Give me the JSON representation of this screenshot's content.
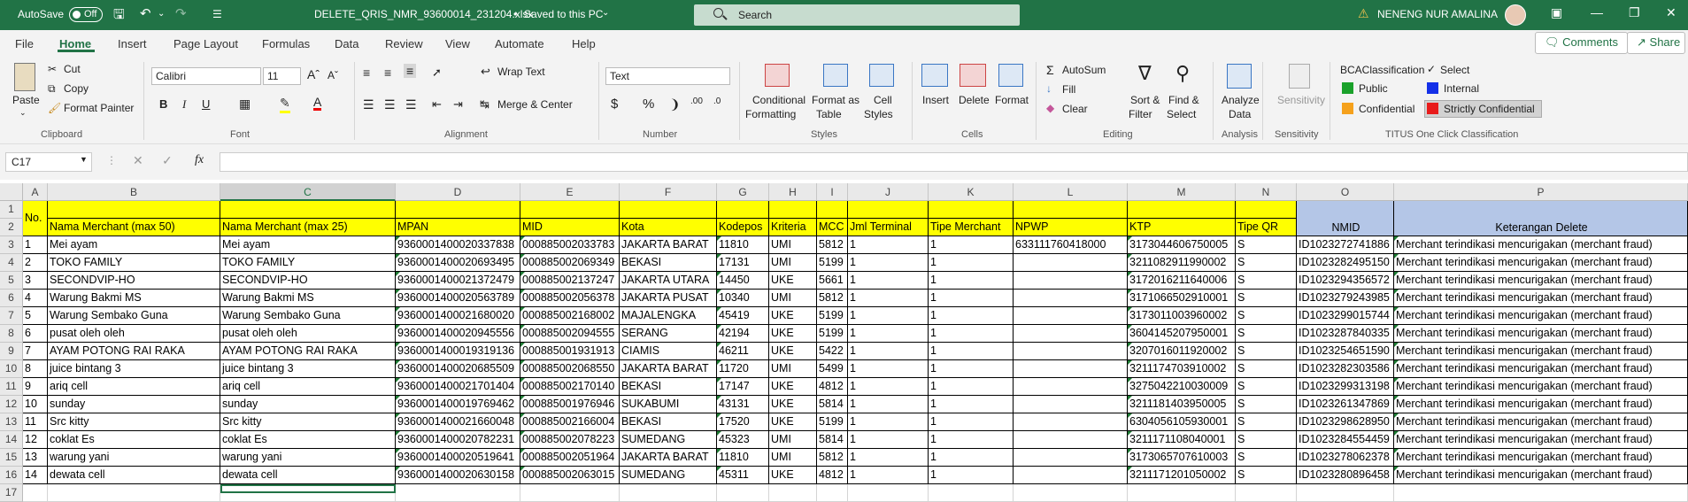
{
  "titlebar": {
    "autosave": "AutoSave",
    "toggle": "Off",
    "filename": "DELETE_QRIS_NMR_93600014_231204.xlsx",
    "saved": "Saved to this PC",
    "search_placeholder": "Search",
    "user": "NENENG NUR AMALINA",
    "color": "#217346"
  },
  "menu": {
    "tabs": [
      "File",
      "Home",
      "Insert",
      "Page Layout",
      "Formulas",
      "Data",
      "Review",
      "View",
      "Automate",
      "Help"
    ],
    "comments": "Comments",
    "share": "Share"
  },
  "ribbon": {
    "clipboard": {
      "paste": "Paste",
      "cut": "Cut",
      "copy": "Copy",
      "painter": "Format Painter",
      "label": "Clipboard"
    },
    "font": {
      "name": "Calibri",
      "size": "11",
      "label": "Font",
      "bold": "B",
      "italic": "I",
      "underline": "U"
    },
    "alignment": {
      "wrap": "Wrap Text",
      "merge": "Merge & Center",
      "label": "Alignment"
    },
    "number": {
      "format": "Text",
      "label": "Number"
    },
    "styles": {
      "cond1": "Conditional",
      "cond2": "Formatting",
      "fmt1": "Format as",
      "fmt2": "Table",
      "cell1": "Cell",
      "cell2": "Styles",
      "label": "Styles"
    },
    "cells": {
      "insert": "Insert",
      "delete": "Delete",
      "format": "Format",
      "label": "Cells"
    },
    "editing": {
      "autosum": "AutoSum",
      "fill": "Fill",
      "clear": "Clear",
      "sort1": "Sort &",
      "sort2": "Filter",
      "find1": "Find &",
      "find2": "Select",
      "label": "Editing"
    },
    "analysis": {
      "a1": "Analyze",
      "a2": "Data",
      "label": "Analysis"
    },
    "sensitivity": {
      "s1": "Sensitivity",
      "label": "Sensitivity"
    },
    "titus": {
      "bca": "BCAClassification",
      "select": "Select",
      "public": "Public",
      "internal": "Internal",
      "confidential": "Confidential",
      "strict": "Strictly Confidential",
      "label": "TITUS One Click Classification"
    }
  },
  "formula": {
    "namebox": "C17",
    "fx": "fx",
    "content": ""
  },
  "sheet": {
    "columns": [
      "A",
      "B",
      "C",
      "D",
      "E",
      "F",
      "G",
      "H",
      "I",
      "J",
      "K",
      "L",
      "M",
      "N",
      "O",
      "P"
    ],
    "header_no": "No.",
    "headers": [
      "Nama Merchant (max 50)",
      "Nama Merchant (max 25)",
      "MPAN",
      "MID",
      "Kota",
      "Kodepos",
      "Kriteria",
      "MCC",
      "Jml Terminal",
      "Tipe Merchant",
      "NPWP",
      "KTP",
      "Tipe QR",
      "NMID",
      "Keterangan Delete"
    ],
    "rows": [
      [
        "1",
        "Mei ayam",
        "Mei ayam",
        "9360001400020337838",
        "000885002033783",
        "JAKARTA BARAT",
        "11810",
        "UMI",
        "5812",
        "1",
        "1",
        "633111760418000",
        "3173044606750005",
        "S",
        "ID1023272741886",
        "Merchant terindikasi mencurigakan (merchant fraud)"
      ],
      [
        "2",
        "TOKO FAMILY",
        "TOKO FAMILY",
        "9360001400020693495",
        "000885002069349",
        "BEKASI",
        "17131",
        "UMI",
        "5199",
        "1",
        "1",
        "",
        "3211082911990002",
        "S",
        "ID1023282495150",
        "Merchant terindikasi mencurigakan (merchant fraud)"
      ],
      [
        "3",
        "SECONDVIP-HO",
        "SECONDVIP-HO",
        "9360001400021372479",
        "000885002137247",
        "JAKARTA UTARA",
        "14450",
        "UKE",
        "5661",
        "1",
        "1",
        "",
        "3172016211640006",
        "S",
        "ID1023294356572",
        "Merchant terindikasi mencurigakan (merchant fraud)"
      ],
      [
        "4",
        "Warung Bakmi MS",
        "Warung Bakmi MS",
        "9360001400020563789",
        "000885002056378",
        "JAKARTA PUSAT",
        "10340",
        "UMI",
        "5812",
        "1",
        "1",
        "",
        "3171066502910001",
        "S",
        "ID1023279243985",
        "Merchant terindikasi mencurigakan (merchant fraud)"
      ],
      [
        "5",
        "Warung Sembako Guna",
        "Warung Sembako Guna",
        "9360001400021680020",
        "000885002168002",
        "MAJALENGKA",
        "45419",
        "UKE",
        "5199",
        "1",
        "1",
        "",
        "3173011003960002",
        "S",
        "ID1023299015744",
        "Merchant terindikasi mencurigakan (merchant fraud)"
      ],
      [
        "6",
        "pusat oleh oleh",
        "pusat oleh oleh",
        "9360001400020945556",
        "000885002094555",
        "SERANG",
        "42194",
        "UKE",
        "5199",
        "1",
        "1",
        "",
        "3604145207950001",
        "S",
        "ID1023287840335",
        "Merchant terindikasi mencurigakan (merchant fraud)"
      ],
      [
        "7",
        "AYAM POTONG RAI RAKA",
        "AYAM POTONG RAI RAKA",
        "9360001400019319136",
        "000885001931913",
        "CIAMIS",
        "46211",
        "UKE",
        "5422",
        "1",
        "1",
        "",
        "3207016011920002",
        "S",
        "ID1023254651590",
        "Merchant terindikasi mencurigakan (merchant fraud)"
      ],
      [
        "8",
        "juice bintang 3",
        "juice bintang 3",
        "9360001400020685509",
        "000885002068550",
        "JAKARTA BARAT",
        "11720",
        "UMI",
        "5499",
        "1",
        "1",
        "",
        "3211174703910002",
        "S",
        "ID1023282303586",
        "Merchant terindikasi mencurigakan (merchant fraud)"
      ],
      [
        "9",
        "ariq cell",
        "ariq cell",
        "9360001400021701404",
        "000885002170140",
        "BEKASI",
        "17147",
        "UKE",
        "4812",
        "1",
        "1",
        "",
        "3275042210030009",
        "S",
        "ID1023299313198",
        "Merchant terindikasi mencurigakan (merchant fraud)"
      ],
      [
        "10",
        "sunday",
        "sunday",
        "9360001400019769462",
        "000885001976946",
        "SUKABUMI",
        "43131",
        "UKE",
        "5814",
        "1",
        "1",
        "",
        "3211181403950005",
        "S",
        "ID1023261347869",
        "Merchant terindikasi mencurigakan (merchant fraud)"
      ],
      [
        "11",
        "Src kitty",
        "Src kitty",
        "9360001400021660048",
        "000885002166004",
        "BEKASI",
        "17520",
        "UKE",
        "5199",
        "1",
        "1",
        "",
        "6304056105930001",
        "S",
        "ID1023298628950",
        "Merchant terindikasi mencurigakan (merchant fraud)"
      ],
      [
        "12",
        "coklat Es",
        "coklat Es",
        "9360001400020782231",
        "000885002078223",
        "SUMEDANG",
        "45323",
        "UMI",
        "5814",
        "1",
        "1",
        "",
        "3211171108040001",
        "S",
        "ID1023284554459",
        "Merchant terindikasi mencurigakan (merchant fraud)"
      ],
      [
        "13",
        "warung yani",
        "warung yani",
        "9360001400020519641",
        "000885002051964",
        "JAKARTA BARAT",
        "11810",
        "UMI",
        "5812",
        "1",
        "1",
        "",
        "3173065707610003",
        "S",
        "ID1023278062378",
        "Merchant terindikasi mencurigakan (merchant fraud)"
      ],
      [
        "14",
        "dewata cell",
        "dewata cell",
        "9360001400020630158",
        "000885002063015",
        "SUMEDANG",
        "45311",
        "UKE",
        "4812",
        "1",
        "1",
        "",
        "3211171201050002",
        "S",
        "ID1023280896458",
        "Merchant terindikasi mencurigakan (merchant fraud)"
      ]
    ]
  }
}
